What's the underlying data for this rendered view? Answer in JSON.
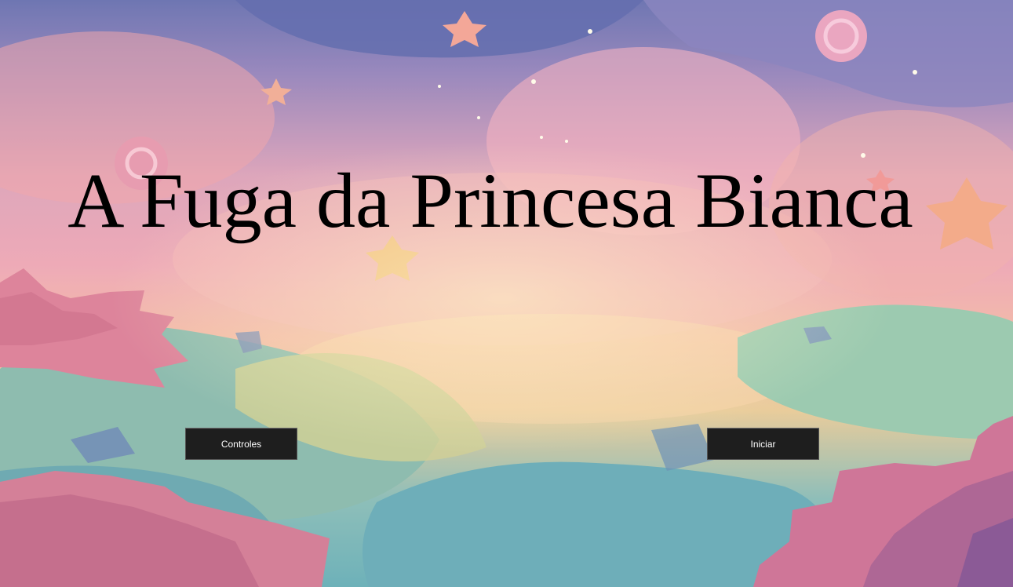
{
  "game": {
    "title": "A Fuga da Princesa Bianca"
  },
  "menu": {
    "controls_label": "Controles",
    "start_label": "Iniciar"
  },
  "colors": {
    "button_bg": "#1e1e1e",
    "button_text": "#ffffff",
    "title_text": "#000000"
  }
}
